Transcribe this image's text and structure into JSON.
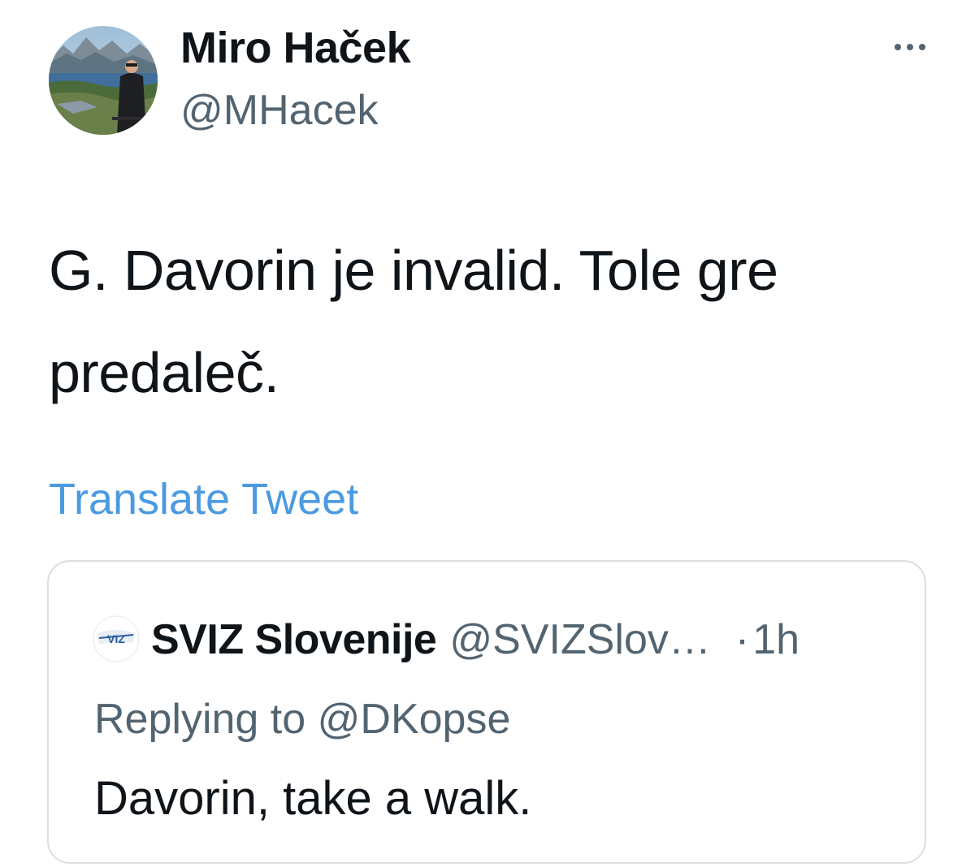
{
  "author": {
    "display_name": "Miro Haček",
    "handle": "@MHacek",
    "avatar_icon": "profile-photo-landscape"
  },
  "more_icon": "ellipsis-icon",
  "tweet": {
    "text": "G. Davorin je invalid. Tole gre predaleč.",
    "translate_label": "Translate Tweet"
  },
  "quoted_tweet": {
    "avatar_text": "VIZ",
    "display_name": "SVIZ Slovenije",
    "handle": "@SVIZSlov…",
    "separator": "·",
    "time": "1h",
    "replying_prefix": "Replying to",
    "replying_handle": "@DKopse",
    "text": "Davorin, take a walk."
  },
  "colors": {
    "link": "#4c9ae0",
    "secondary_text": "#536471",
    "primary_text": "#0f1419",
    "border": "#d9dee3"
  }
}
